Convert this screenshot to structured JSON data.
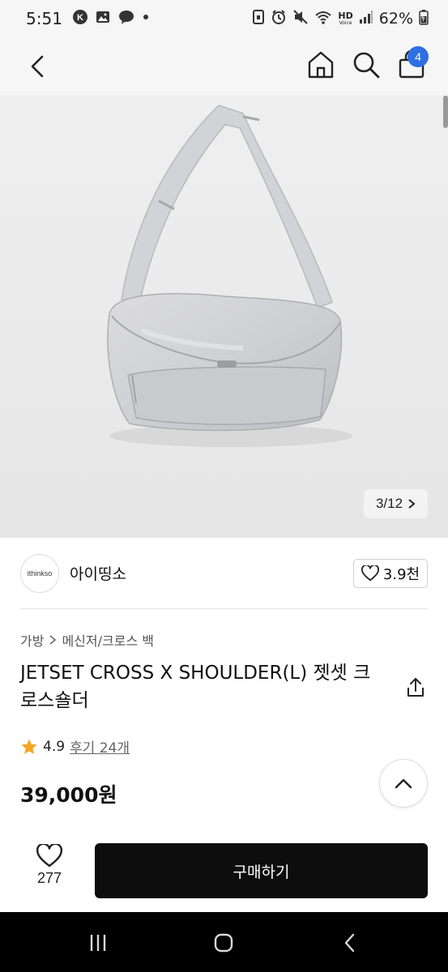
{
  "status_bar": {
    "time": "5:51",
    "hd_label": "HD",
    "voice_label": "Voice",
    "battery": "62%"
  },
  "app_bar": {
    "cart_count": "4",
    "icons": [
      "back-arrow-icon",
      "home-icon",
      "search-icon",
      "shopping-bag-icon"
    ]
  },
  "gallery": {
    "counter": "3/12"
  },
  "shop": {
    "logo_text": "ithinkso",
    "name": "아이띵소",
    "likes": "3.9천"
  },
  "breadcrumb": {
    "level1": "가방",
    "level2": "메신저/크로스 백"
  },
  "product": {
    "title": "JETSET CROSS X SHOULDER(L) 젯셋 크로스숄더",
    "rating": "4.9",
    "reviews": "후기 24개",
    "price": "39,000원"
  },
  "action_bar": {
    "wish_count": "277",
    "buy_label": "구매하기"
  },
  "colors": {
    "accent_badge": "#2f6fe4",
    "star": "#f5a623",
    "buy_button": "#0d0d0d",
    "image_bg": "#ececec"
  }
}
